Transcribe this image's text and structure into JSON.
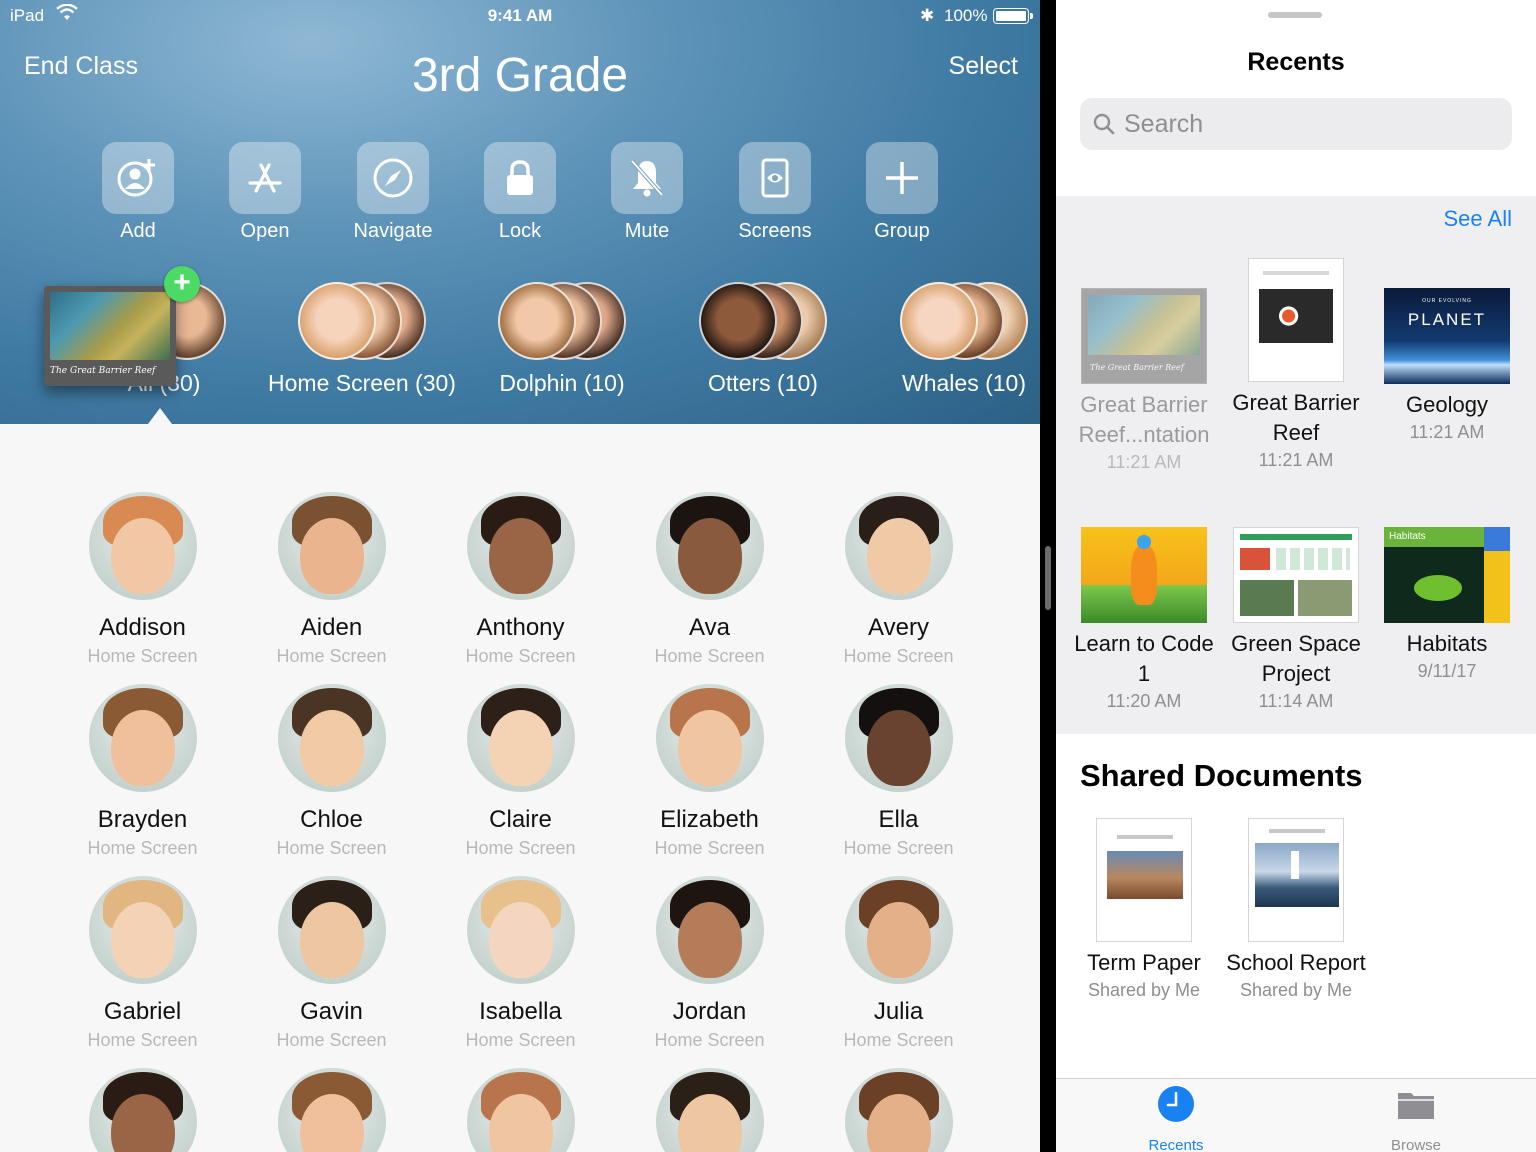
{
  "status_bar": {
    "device": "iPad",
    "time": "9:41 AM",
    "battery": "100%"
  },
  "classroom": {
    "end_class": "End Class",
    "title": "3rd Grade",
    "select": "Select",
    "actions": [
      {
        "label": "Add",
        "icon": "add-person-icon"
      },
      {
        "label": "Open",
        "icon": "app-store-icon"
      },
      {
        "label": "Navigate",
        "icon": "compass-icon"
      },
      {
        "label": "Lock",
        "icon": "lock-icon"
      },
      {
        "label": "Mute",
        "icon": "bell-slash-icon"
      },
      {
        "label": "Screens",
        "icon": "screen-eye-icon"
      },
      {
        "label": "Group",
        "icon": "plus-icon"
      }
    ],
    "groups": [
      {
        "label": "All (30)"
      },
      {
        "label": "Home Screen (30)"
      },
      {
        "label": "Dolphin (10)"
      },
      {
        "label": "Otters (10)"
      },
      {
        "label": "Whales (10)"
      }
    ],
    "drag_preview": {
      "caption": "The Great Barrier Reef"
    },
    "students": [
      {
        "name": "Addison",
        "status": "Home Screen"
      },
      {
        "name": "Aiden",
        "status": "Home Screen"
      },
      {
        "name": "Anthony",
        "status": "Home Screen"
      },
      {
        "name": "Ava",
        "status": "Home Screen"
      },
      {
        "name": "Avery",
        "status": "Home Screen"
      },
      {
        "name": "Brayden",
        "status": "Home Screen"
      },
      {
        "name": "Chloe",
        "status": "Home Screen"
      },
      {
        "name": "Claire",
        "status": "Home Screen"
      },
      {
        "name": "Elizabeth",
        "status": "Home Screen"
      },
      {
        "name": "Ella",
        "status": "Home Screen"
      },
      {
        "name": "Gabriel",
        "status": "Home Screen"
      },
      {
        "name": "Gavin",
        "status": "Home Screen"
      },
      {
        "name": "Isabella",
        "status": "Home Screen"
      },
      {
        "name": "Jordan",
        "status": "Home Screen"
      },
      {
        "name": "Julia",
        "status": "Home Screen"
      }
    ]
  },
  "files": {
    "title": "Recents",
    "search_placeholder": "Search",
    "see_all": "See All",
    "recents": [
      {
        "name": "Great Barrier Reef...ntation",
        "time": "11:21 AM"
      },
      {
        "name": "Great Barrier Reef",
        "time": "11:21 AM"
      },
      {
        "name": "Geology",
        "time": "11:21 AM"
      },
      {
        "name": "Learn to Code 1",
        "time": "11:20 AM"
      },
      {
        "name": "Green Space Project",
        "time": "11:14 AM"
      },
      {
        "name": "Habitats",
        "time": "9/11/17"
      }
    ],
    "thumb_text": {
      "keynote_caption": "The Great Barrier Reef",
      "geology_small": "OUR EVOLVING",
      "geology_big": "PLANET",
      "habitats_tag": "Habitats"
    },
    "shared_title": "Shared Documents",
    "shared": [
      {
        "name": "Term Paper",
        "sub": "Shared by Me"
      },
      {
        "name": "School Report",
        "sub": "Shared by Me"
      }
    ],
    "tabs": [
      {
        "label": "Recents",
        "active": true
      },
      {
        "label": "Browse",
        "active": false
      }
    ]
  },
  "colors": {
    "accent": "#1a82f0",
    "badge_green": "#4cd964"
  }
}
